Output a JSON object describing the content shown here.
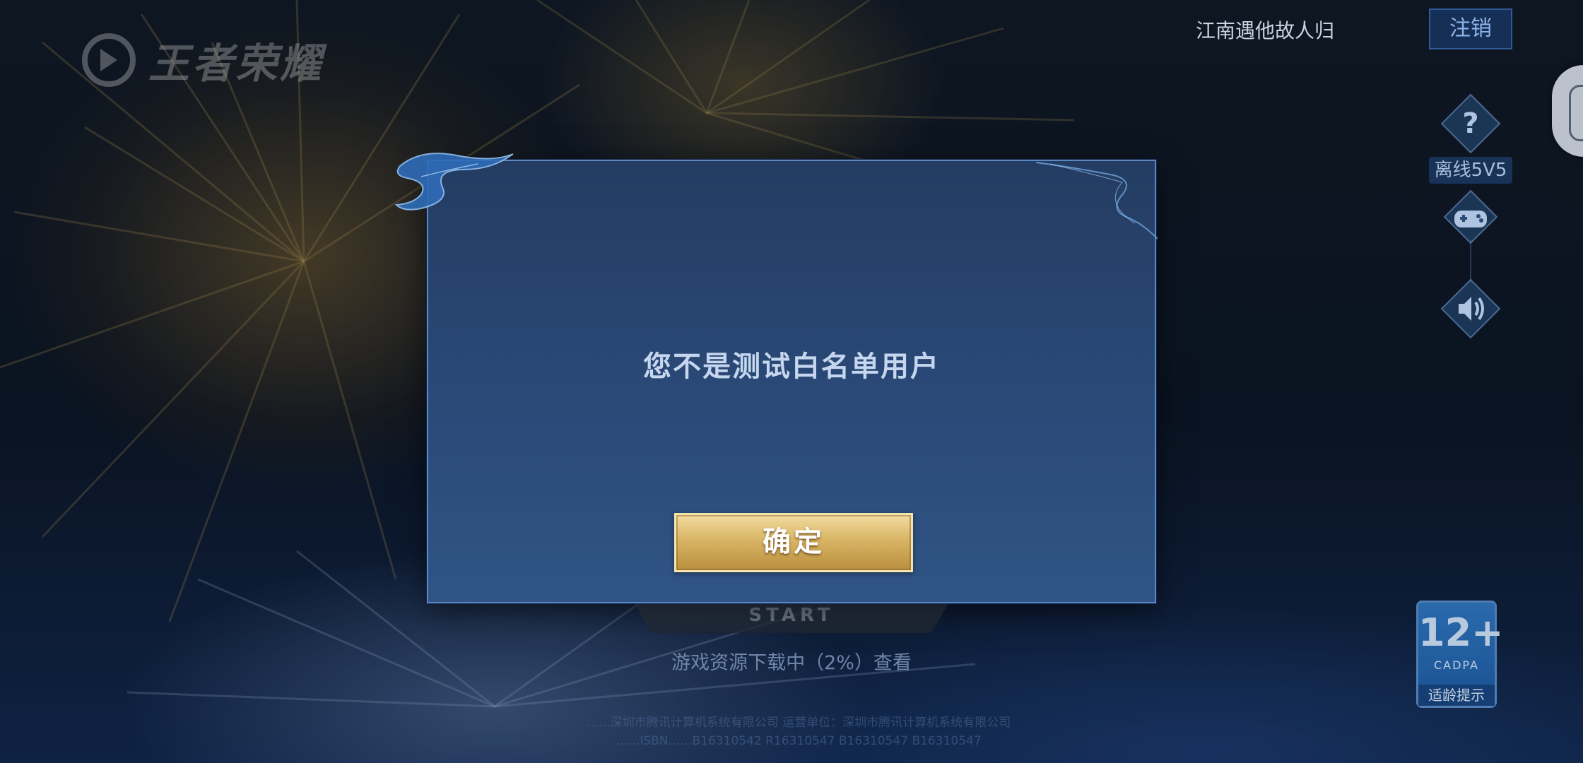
{
  "app": {
    "logo_text": "王者荣耀"
  },
  "user": {
    "name": "江南遇他故人归",
    "logout_label": "注销"
  },
  "side_controls": {
    "help_icon": "question-icon",
    "offline_label": "离线5V5",
    "gamepad_icon": "gamepad-icon",
    "sound_icon": "speaker-icon"
  },
  "start": {
    "sub_label": "START",
    "download_status": "游戏资源下载中（2%）查看"
  },
  "footer": {
    "line1": "……深圳市腾讯计算机系统有限公司  运营单位：深圳市腾讯计算机系统有限公司",
    "line2": "……ISBN……B16310542 R16310547 B16310547 B16310547"
  },
  "age_rating": {
    "number": "12+",
    "org": "CADPA",
    "tip": "适龄提示"
  },
  "dialog": {
    "message": "您不是测试白名单用户",
    "confirm_label": "确定"
  },
  "colors": {
    "dialog_bg": "#2a4a78",
    "dialog_border": "#5a88c2",
    "confirm_gold": "#d9b565",
    "logout_text": "#8fb5e8"
  }
}
